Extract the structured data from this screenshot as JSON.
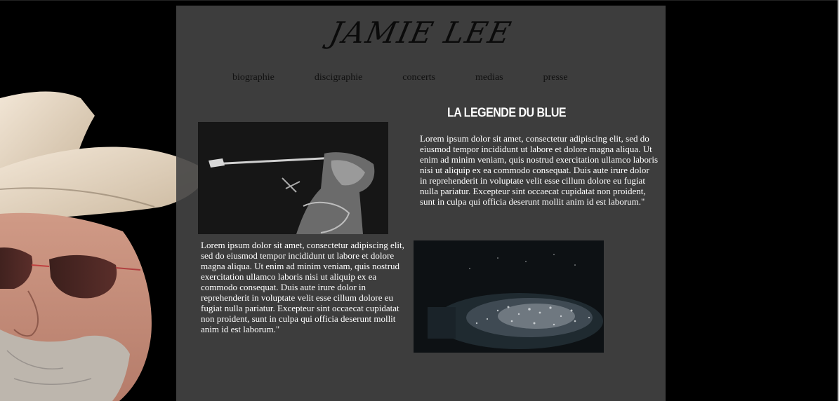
{
  "site": {
    "logo": "JAMIE LEE"
  },
  "nav": {
    "items": [
      {
        "label": "biographie"
      },
      {
        "label": "discigraphie"
      },
      {
        "label": "concerts"
      },
      {
        "label": "medias"
      },
      {
        "label": "presse"
      }
    ]
  },
  "content": {
    "headline": "LA LEGENDE DU BLUE",
    "paragraph1": "Lorem ipsum dolor sit amet, consectetur adipiscing elit, sed do eiusmod tempor incididunt ut labore et dolore magna aliqua. Ut enim ad minim veniam, quis nostrud exercitation ullamco laboris nisi ut aliquip ex ea commodo consequat. Duis aute irure dolor in reprehenderit in voluptate velit esse cillum dolore eu fugiat nulla pariatur. Excepteur sint occaecat cupidatat non proident, sunt in culpa qui officia deserunt mollit anim id est laborum.\"",
    "paragraph2": "Lorem ipsum dolor sit amet, consectetur adipiscing elit, sed do eiusmod tempor incididunt ut labore et dolore magna aliqua. Ut enim ad minim veniam, quis nostrud exercitation ullamco laboris nisi ut aliquip ex ea commodo consequat. Duis aute irure dolor in reprehenderit in voluptate velit esse cillum dolore eu fugiat nulla pariatur. Excepteur sint occaecat cupidatat non proident, sunt in culpa qui officia deserunt mollit anim id est laborum.\""
  },
  "colors": {
    "page_bg": "#000000",
    "panel_bg": "#444444",
    "text": "#ffffff",
    "nav_text": "#111111"
  }
}
